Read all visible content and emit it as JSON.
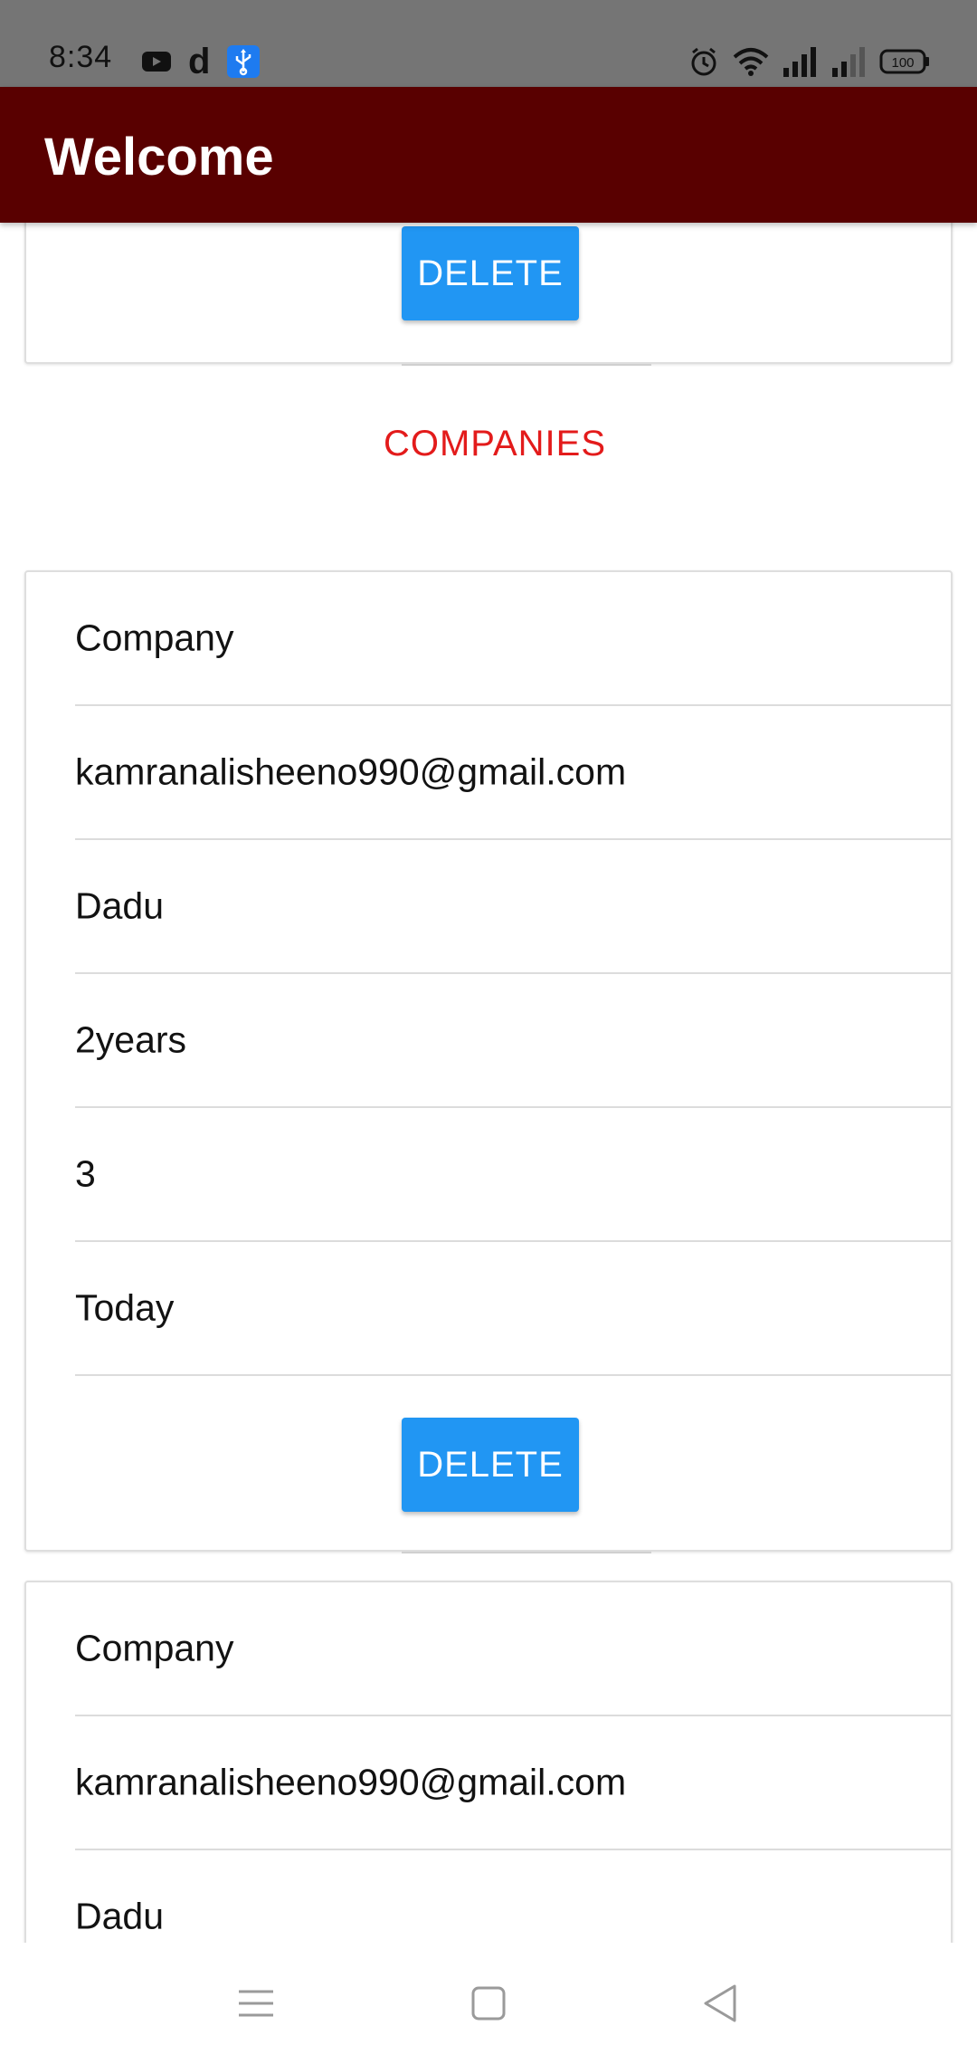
{
  "status_bar": {
    "time": "8:34",
    "left_icons": [
      "youtube-icon",
      "d-app-icon",
      "usb-icon"
    ],
    "right_icons": [
      "alarm-icon",
      "wifi-icon",
      "signal-icon",
      "signal-weak-icon",
      "battery-icon"
    ],
    "app_letter": "d",
    "battery_level": "100"
  },
  "app_bar": {
    "title": "Welcome"
  },
  "top_card": {
    "delete_label": "DELETE"
  },
  "section": {
    "heading": "COMPANIES"
  },
  "companies": [
    {
      "fields": [
        "Company",
        "kamranalisheeno990@gmail.com",
        "Dadu",
        "2years",
        "3",
        "Today"
      ],
      "delete_label": "DELETE"
    },
    {
      "fields": [
        "Company",
        "kamranalisheeno990@gmail.com",
        "Dadu"
      ]
    }
  ],
  "nav_bar": {
    "icons": [
      "menu-icon",
      "home-square-icon",
      "back-triangle-icon"
    ]
  },
  "colors": {
    "status_bar": "#757575",
    "app_bar": "#590000",
    "button": "#2196f3",
    "heading": "#e31b1b"
  }
}
